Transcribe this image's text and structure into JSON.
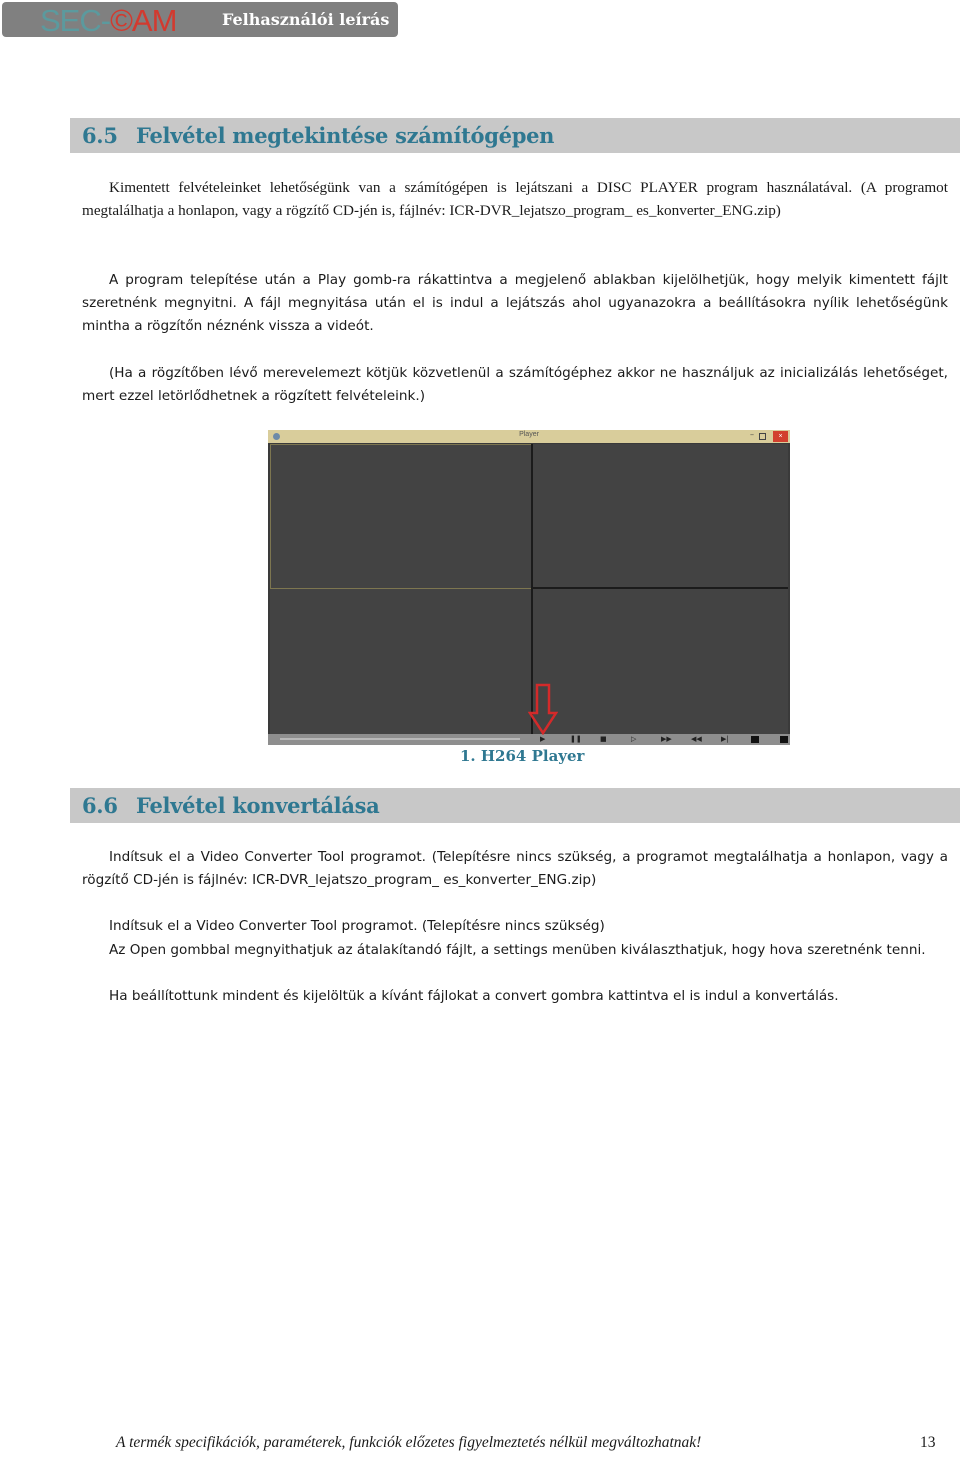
{
  "header": {
    "logo_left": "SEC-",
    "logo_right": "©AM",
    "title": "Felhasználói leírás"
  },
  "section_65": {
    "number": "6.5",
    "title": "Felvétel megtekintése számítógépen",
    "paragraphs": [
      "Kimentett felvételeinket lehetőségünk van a számítógépen is lejátszani a DISC PLAYER program használatával. (A programot megtalálhatja a honlapon, vagy a rögzítő CD-jén is, fájlnév: ICR-DVR_lejatszo_program_ es_konverter_ENG.zip)",
      "A program telepítése után a Play gomb-ra rákattintva a megjelenő ablakban kijelölhetjük, hogy melyik kimentett fájlt szeretnénk megnyitni. A fájl megnyitása után el is indul a lejátszás ahol ugyanazokra a beállításokra nyílik lehetőségünk mintha a rögzítőn néznénk vissza a videót.",
      "(Ha a rögzítőben lévő merevelemezt kötjük közvetlenül a számítógéphez akkor ne használjuk az inicializálás lehetőséget, mert ezzel letörlődhetnek a rögzített felvételeink.)"
    ]
  },
  "player": {
    "window_title": "Player",
    "close_glyph": "×",
    "minimize_glyph": "–",
    "controls": [
      "▶",
      "❚❚",
      "■",
      "▷",
      "▶▶",
      "◀◀",
      "▶|"
    ]
  },
  "figure_caption": "1.   H264 Player",
  "section_66": {
    "number": "6.6",
    "title": "Felvétel konvertálása",
    "paragraphs": [
      "Indítsuk el a Video Converter Tool programot. (Telepítésre nincs szükség, a programot megtalálhatja a honlapon, vagy a rögzítő CD-jén is fájlnév: ICR-DVR_lejatszo_program_ es_konverter_ENG.zip)",
      "Indítsuk el a Video Converter Tool programot. (Telepítésre nincs szükség)",
      "Az Open gombbal megnyithatjuk az átalakítandó fájlt, a settings menüben kiválaszthatjuk, hogy hova szeretnénk tenni.",
      "Ha beállítottunk mindent és kijelöltük a kívánt fájlokat a convert gombra kattintva el is indul a konvertálás."
    ]
  },
  "footer": {
    "text": "A termék specifikációk, paraméterek, funkciók előzetes figyelmeztetés nélkül megváltozhatnak!",
    "page_number": "13"
  }
}
